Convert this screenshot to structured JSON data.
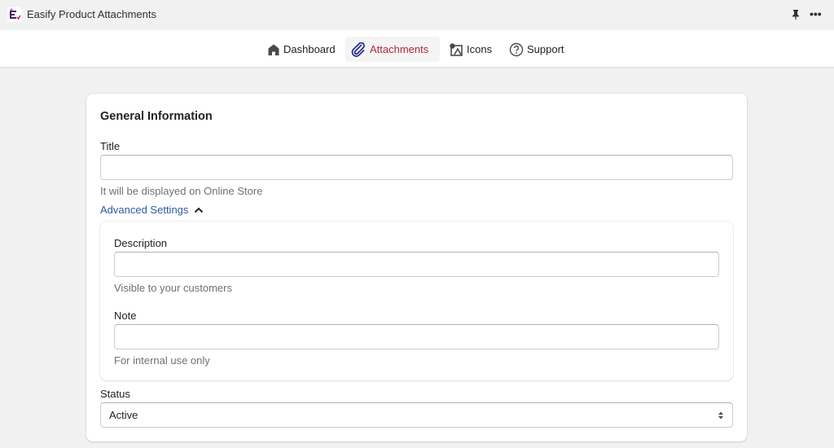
{
  "titlebar": {
    "app_title": "Easify Product Attachments",
    "logo_icon": "easify-logo-icon",
    "pin_icon": "pin-icon",
    "more_icon": "more-horizontal-icon",
    "more_glyph": "•••"
  },
  "nav": {
    "items": [
      {
        "label": "Dashboard",
        "icon": "home-icon",
        "active": false
      },
      {
        "label": "Attachments",
        "icon": "paperclip-icon",
        "active": true
      },
      {
        "label": "Icons",
        "icon": "image-icon",
        "active": false
      },
      {
        "label": "Support",
        "icon": "help-circle-icon",
        "active": false
      }
    ]
  },
  "form": {
    "section_title": "General Information",
    "title_field": {
      "label": "Title",
      "value": "",
      "placeholder": "",
      "help": "It will be displayed on Online Store"
    },
    "advanced_toggle": {
      "label": "Advanced Settings",
      "expanded": true,
      "icon": "chevron-up-icon"
    },
    "description_field": {
      "label": "Description",
      "value": "",
      "placeholder": "",
      "help": "Visible to your customers"
    },
    "note_field": {
      "label": "Note",
      "value": "",
      "placeholder": "",
      "help": "For internal use only"
    },
    "status_field": {
      "label": "Status",
      "selected": "Active",
      "icon": "select-arrows-icon"
    }
  },
  "colors": {
    "active_nav_text": "#b02a37",
    "active_nav_icon": "#2b2a8c",
    "link": "#2c5aa0",
    "page_bg": "#f1f1f1"
  }
}
